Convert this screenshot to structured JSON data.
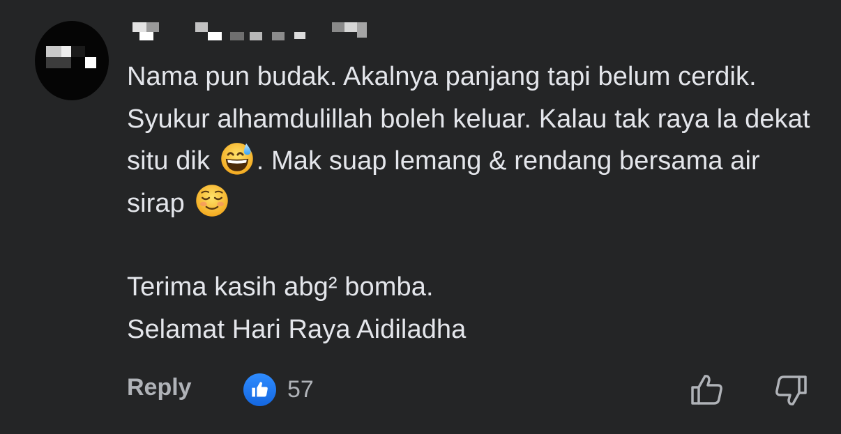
{
  "comment": {
    "author_redacted": true,
    "paragraphs": [
      {
        "parts": [
          {
            "type": "text",
            "value": "Nama pun budak. Akalnya panjang tapi belum cerdik. Syukur alhamdulillah boleh keluar. Kalau tak raya la dekat situ dik "
          },
          {
            "type": "emoji",
            "icon": "grinning-sweat-emoji"
          },
          {
            "type": "text",
            "value": ". Mak suap lemang & rendang bersama air sirap "
          },
          {
            "type": "emoji",
            "icon": "smiling-face-emoji"
          }
        ]
      },
      {
        "lines": [
          "Terima kasih abg² bomba.",
          "Selamat Hari Raya Aidiladha"
        ]
      }
    ]
  },
  "actions": {
    "reply_label": "Reply",
    "reaction_icon": "like-icon",
    "reaction_count": "57",
    "upvote_icon": "thumbs-up-outline-icon",
    "downvote_icon": "thumbs-down-outline-icon"
  },
  "colors": {
    "background": "#242526",
    "text_primary": "#e4e6eb",
    "text_secondary": "#b0b3b8",
    "like_blue": "#1877f2"
  }
}
